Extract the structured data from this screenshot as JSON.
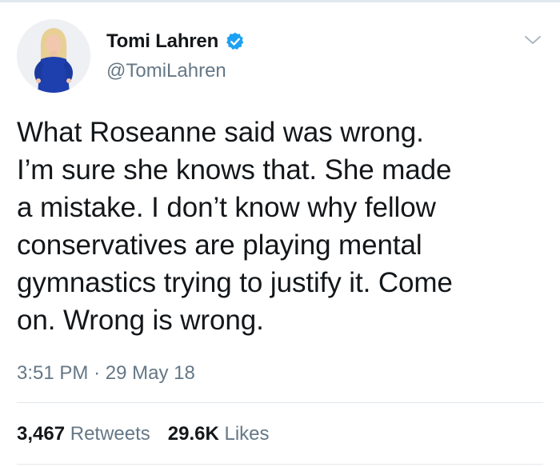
{
  "user": {
    "display_name": "Tomi Lahren",
    "handle": "@TomiLahren",
    "verified": true,
    "avatar_icon": "profile-photo"
  },
  "tweet": {
    "text": "What Roseanne said was wrong.\nI’m sure she knows that. She made\na mistake. I don’t know why fellow\nconservatives are playing mental\ngymnastics trying to justify it. Come\non. Wrong is wrong.",
    "time": "3:51 PM",
    "separator": "·",
    "date": "29 May 18"
  },
  "stats": {
    "retweets_count": "3,467",
    "retweets_label": "Retweets",
    "likes_count": "29.6K",
    "likes_label": "Likes"
  },
  "colors": {
    "text": "#14171a",
    "secondary": "#657786",
    "verified": "#1da1f2",
    "divider": "#e1e8ed"
  },
  "icons": {
    "verified": "verified-badge-icon",
    "menu": "chevron-down-icon"
  }
}
